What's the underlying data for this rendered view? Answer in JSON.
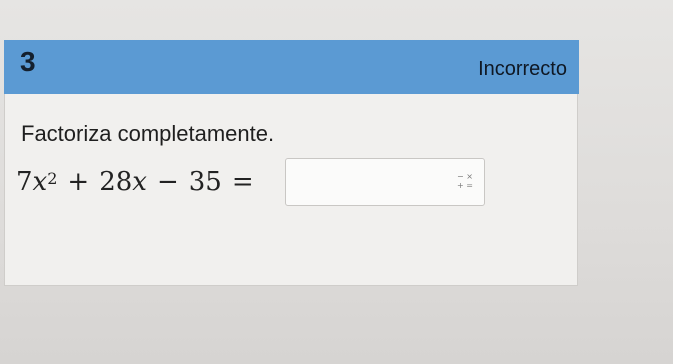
{
  "question": {
    "number": "3",
    "status": "Incorrecto",
    "instruction": "Factoriza completamente.",
    "equation": {
      "coef1": "7",
      "var1": "x",
      "exp1": "2",
      "op1": "+",
      "term2": "28",
      "var2": "x",
      "op2": "−",
      "term3": "35",
      "equals": "="
    },
    "answer": {
      "value": "",
      "placeholder": ""
    },
    "keypad_icon": {
      "line1": "− ×",
      "line2": "+ ="
    }
  },
  "colors": {
    "header_bg": "#5b9ad3",
    "card_bg": "#f1f0ee"
  }
}
